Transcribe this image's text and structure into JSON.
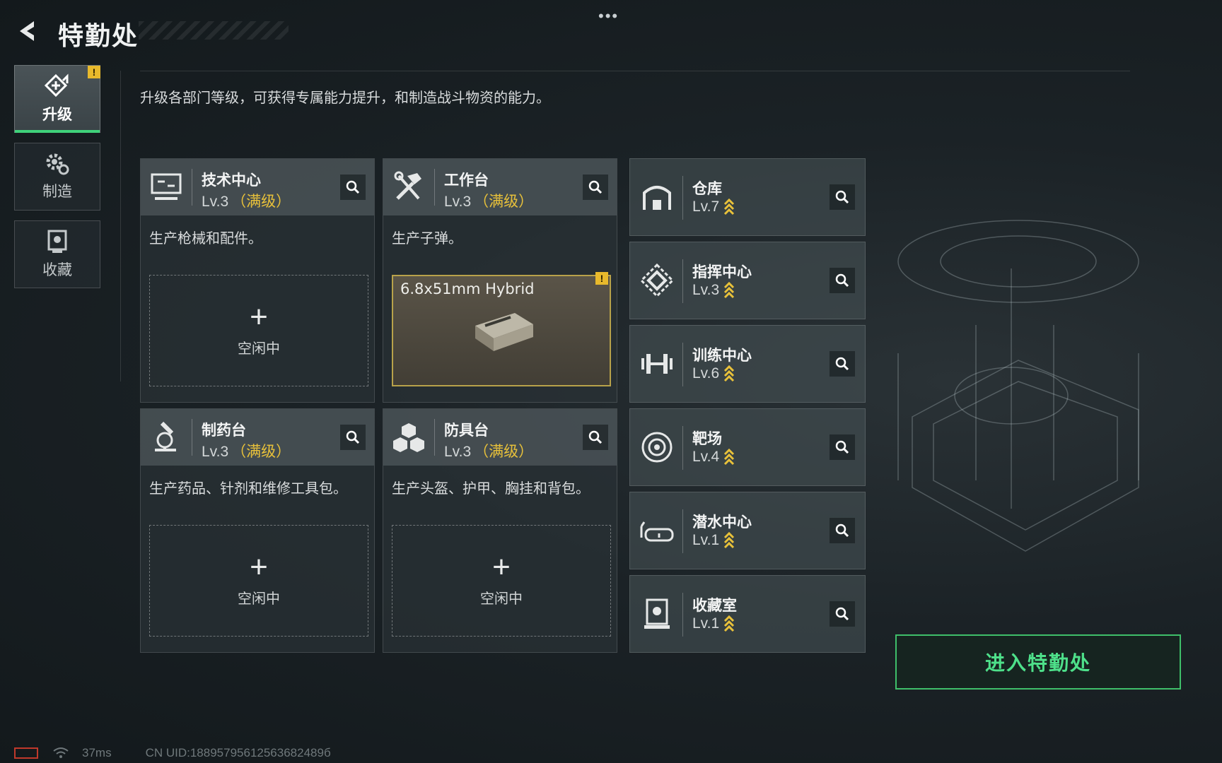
{
  "header": {
    "title": "特勤处",
    "more": "•••"
  },
  "description": "升级各部门等级，可获得专属能力提升，和制造战斗物资的能力。",
  "nav": [
    {
      "label": "升级",
      "icon": "upgrade-icon",
      "active": true,
      "badge": "!"
    },
    {
      "label": "制造",
      "icon": "gear-icon"
    },
    {
      "label": "收藏",
      "icon": "collection-icon"
    }
  ],
  "cards": [
    {
      "name": "技术中心",
      "level": "Lv.3",
      "max": "（满级）",
      "desc": "生产枪械和配件。",
      "slot": {
        "state": "空闲中"
      }
    },
    {
      "name": "工作台",
      "level": "Lv.3",
      "max": "（满级）",
      "desc": "生产子弹。",
      "slot": {
        "item": "6.8x51mm Hybrid",
        "badge": "!"
      }
    },
    {
      "name": "制药台",
      "level": "Lv.3",
      "max": "（满级）",
      "desc": "生产药品、针剂和维修工具包。",
      "slot": {
        "state": "空闲中"
      }
    },
    {
      "name": "防具台",
      "level": "Lv.3",
      "max": "（满级）",
      "desc": "生产头盔、护甲、胸挂和背包。",
      "slot": {
        "state": "空闲中"
      }
    }
  ],
  "departments": [
    {
      "name": "仓库",
      "level": "Lv.7"
    },
    {
      "name": "指挥中心",
      "level": "Lv.3"
    },
    {
      "name": "训练中心",
      "level": "Lv.6"
    },
    {
      "name": "靶场",
      "level": "Lv.4"
    },
    {
      "name": "潜水中心",
      "level": "Lv.1"
    },
    {
      "name": "收藏室",
      "level": "Lv.1"
    }
  ],
  "enter_button": "进入特勤处",
  "status": {
    "ping": "37ms",
    "uid": "CN UID:18895795612563682489б"
  },
  "colors": {
    "accent": "#3fd27a",
    "max": "#e8c13a",
    "badge": "#e8b92c"
  }
}
